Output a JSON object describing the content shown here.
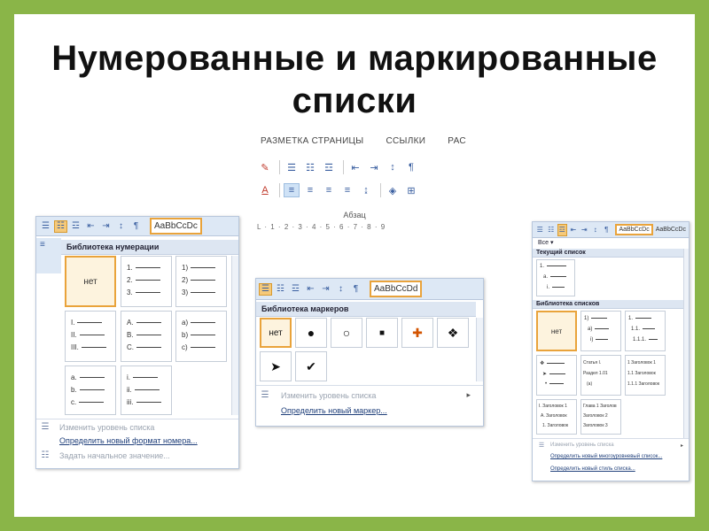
{
  "title": {
    "line1": "Нумерованные и маркированные",
    "line2": "списки"
  },
  "ribbon": {
    "tabs": [
      "РАЗМЕТКА СТРАНИЦЫ",
      "ССЫЛКИ",
      "РАС"
    ],
    "group_label": "Абзац",
    "ruler": "L · 1 · 2 · 3 · 4 · 5 · 6 · 7 · 8 · 9"
  },
  "numbering": {
    "style_label": "AaBbCcDc",
    "header": "Библиотека нумерации",
    "none_label": "нет",
    "cells": [
      [
        "1.",
        "2.",
        "3."
      ],
      [
        "1)",
        "2)",
        "3)"
      ],
      [
        "I.",
        "II.",
        "III."
      ],
      [
        "A.",
        "B.",
        "C."
      ],
      [
        "a)",
        "b)",
        "c)"
      ],
      [
        "a.",
        "b.",
        "c."
      ],
      [
        "i.",
        "ii.",
        "iii."
      ]
    ],
    "menu": [
      {
        "label": "Изменить уровень списка",
        "state": "disabled"
      },
      {
        "label": "Определить новый формат номера...",
        "state": "active"
      },
      {
        "label": "Задать начальное значение...",
        "state": "disabled"
      }
    ]
  },
  "bullets": {
    "style_label": "AaBbCcDd",
    "header": "Библиотека маркеров",
    "none_label": "нет",
    "symbols": [
      "●",
      "○",
      "■",
      "✚",
      "❖",
      "➤",
      "✔"
    ],
    "menu": [
      {
        "label": "Изменить уровень списка",
        "state": "disabled"
      },
      {
        "label": "Определить новый маркер...",
        "state": "active"
      }
    ]
  },
  "multilevel": {
    "style_label": "AaBbCcDc",
    "style_label2": "AaBbCcDc",
    "filter_label": "Все ▾",
    "current_header": "Текущий список",
    "library_header": "Библиотека списков",
    "none_label": "нет",
    "current_lines": [
      "1.",
      "a.",
      "i."
    ],
    "cells": [
      [
        "1)",
        "a)",
        "i)"
      ],
      [
        "1.",
        "1.1.",
        "1.1.1."
      ],
      [
        "❖",
        "➤",
        "•"
      ],
      [
        "Статья I.",
        "Раздел 1.01",
        "(a)"
      ],
      [
        "1 Заголовок 1",
        "1.1 Заголовок",
        "1.1.1 Заголовок"
      ],
      [
        "I. Заголовок 1",
        "A. Заголовок",
        "1. Заголовок"
      ],
      [
        "Глава 1 Заголов",
        "Заголовок 2",
        "Заголовок 3"
      ]
    ],
    "menu": [
      {
        "label": "Изменить уровень списка",
        "state": "disabled"
      },
      {
        "label": "Определить новый многоуровневый список...",
        "state": "active"
      },
      {
        "label": "Определить новый стиль списка...",
        "state": "active"
      }
    ]
  }
}
